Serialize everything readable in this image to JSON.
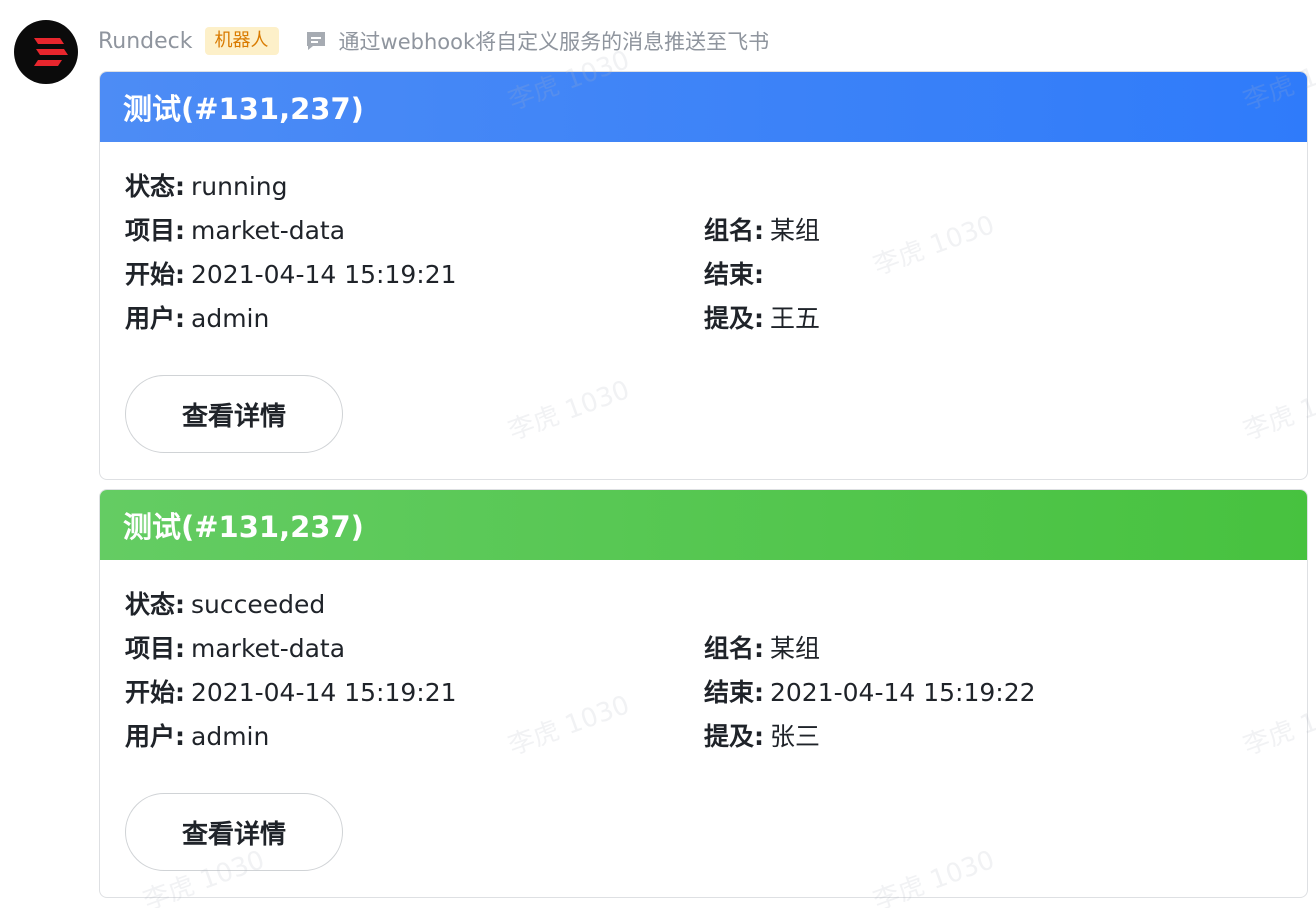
{
  "sender": {
    "name": "Rundeck",
    "badge": "机器人",
    "description": "通过webhook将自定义服务的消息推送至飞书"
  },
  "cards": [
    {
      "title": "测试(#131,237)",
      "header_color": "#3a82f7",
      "status_label": "状态:",
      "status": "running",
      "project_label": "项目:",
      "project": "market-data",
      "group_label": "组名:",
      "group": "某组",
      "start_label": "开始:",
      "start": "2021-04-14 15:19:21",
      "end_label": "结束:",
      "end": "",
      "user_label": "用户:",
      "user": "admin",
      "mention_label": "提及:",
      "mention": "王五",
      "button": "查看详情"
    },
    {
      "title": "测试(#131,237)",
      "header_color": "#52c54a",
      "status_label": "状态:",
      "status": "succeeded",
      "project_label": "项目:",
      "project": "market-data",
      "group_label": "组名:",
      "group": "某组",
      "start_label": "开始:",
      "start": "2021-04-14 15:19:21",
      "end_label": "结束:",
      "end": "2021-04-14 15:19:22",
      "user_label": "用户:",
      "user": "admin",
      "mention_label": "提及:",
      "mention": "张三",
      "button": "查看详情"
    }
  ],
  "watermark": "李虎 1030"
}
